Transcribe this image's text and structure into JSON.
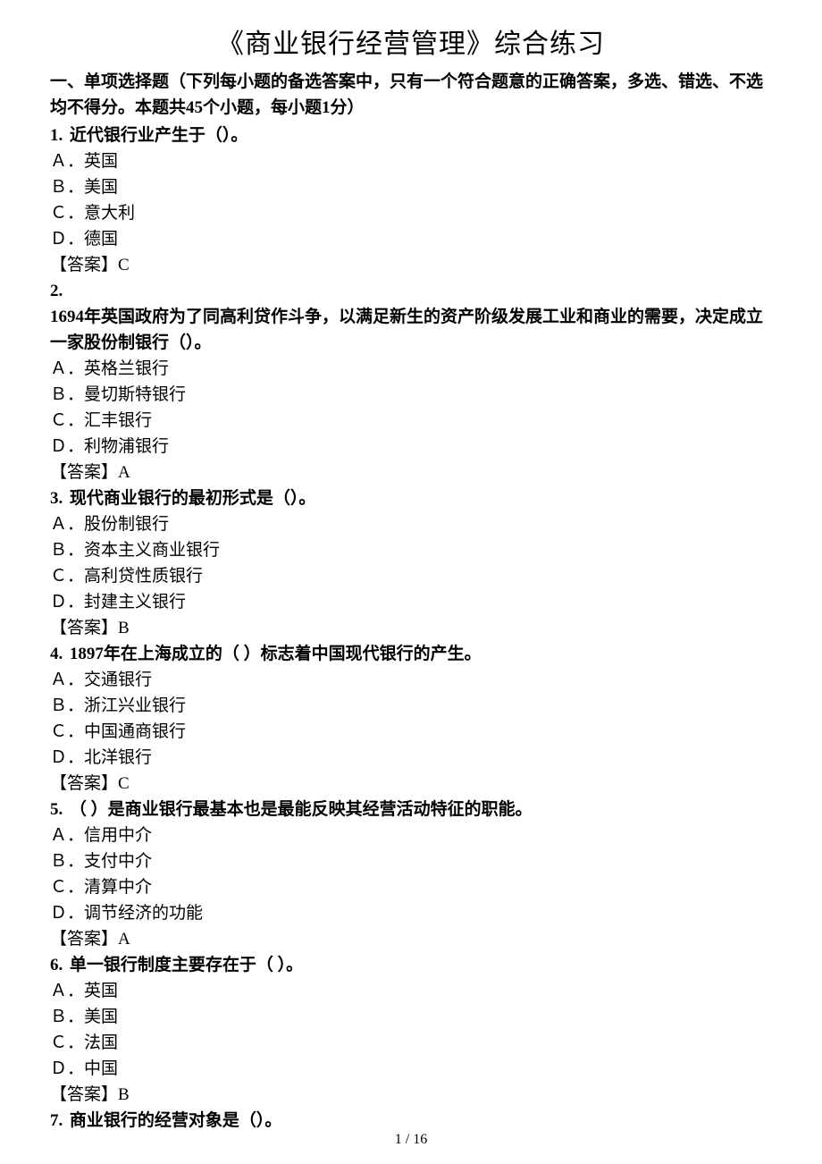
{
  "title": "《商业银行经营管理》综合练习",
  "instruction": "一、单项选择题（下列每小题的备选答案中，只有一个符合题意的正确答案，多选、错选、不选均不得分。本题共45个小题，每小题1分）",
  "q1": {
    "num": "1.",
    "stem": "近代银行业产生于（）。",
    "a": "Ａ．英国",
    "b": "Ｂ．美国",
    "c": "Ｃ．意大利",
    "d": "Ｄ．德国",
    "ans": "【答案】C"
  },
  "q2": {
    "num": "2.",
    "stem": "1694年英国政府为了同高利贷作斗争，以满足新生的资产阶级发展工业和商业的需要，决定成立一家股份制银行（）。",
    "a": "Ａ．英格兰银行",
    "b": "Ｂ．曼切斯特银行",
    "c": "Ｃ．汇丰银行",
    "d": "Ｄ．利物浦银行",
    "ans": "【答案】A"
  },
  "q3": {
    "num": "3.",
    "stem": "现代商业银行的最初形式是（）。",
    "a": "Ａ．股份制银行",
    "b": "Ｂ．资本主义商业银行",
    "c": "Ｃ．高利贷性质银行",
    "d": "Ｄ．封建主义银行",
    "ans": "【答案】B"
  },
  "q4": {
    "num": "4.",
    "stem": "1897年在上海成立的（ ）标志着中国现代银行的产生。",
    "a": "Ａ．交通银行",
    "b": "Ｂ．浙江兴业银行",
    "c": "Ｃ．中国通商银行",
    "d": "Ｄ．北洋银行",
    "ans": "【答案】C"
  },
  "q5": {
    "num": "5.",
    "stem": "（ ）是商业银行最基本也是最能反映其经营活动特征的职能。",
    "a": "Ａ．信用中介",
    "b": "Ｂ．支付中介",
    "c": "Ｃ．清算中介",
    "d": "Ｄ．调节经济的功能",
    "ans": "【答案】A"
  },
  "q6": {
    "num": "6.",
    "stem": "单一银行制度主要存在于（ ）。",
    "a": "Ａ．英国",
    "b": "Ｂ．美国",
    "c": "Ｃ．法国",
    "d": "Ｄ．中国",
    "ans": "【答案】B"
  },
  "q7": {
    "num": "7.",
    "stem": "商业银行的经营对象是（）。"
  },
  "footer": "1 / 16"
}
